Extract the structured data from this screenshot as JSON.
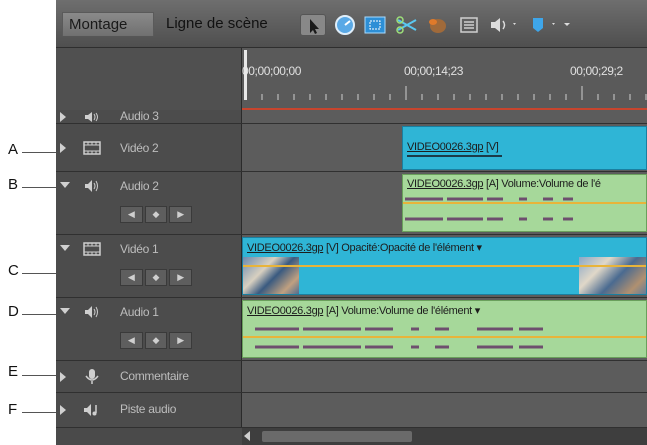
{
  "tabs": {
    "montage": "Montage",
    "ligne": "Ligne de scène"
  },
  "ruler": {
    "t0": "00;00;00;00",
    "t1": "00;00;14;23",
    "t2": "00;00;29;2"
  },
  "tracks": {
    "audio3": "Audio 3",
    "video2": "Vidéo 2",
    "audio2": "Audio 2",
    "video1": "Vidéo 1",
    "audio1": "Audio 1",
    "commentaire": "Commentaire",
    "piste": "Piste audio"
  },
  "clips": {
    "v2_file": "VIDEO0026.3gp",
    "v2_tag": " [V]",
    "a2_file": "VIDEO0026.3gp",
    "a2_tag": " [A]  Volume:Volume de l'é",
    "v1_file": "VIDEO0026.3gp",
    "v1_tag": " [V]  Opacité:Opacité de l'élément ▾",
    "a1_file": "VIDEO0026.3gp",
    "a1_tag": " [A]  Volume:Volume de l'élément ▾"
  },
  "keyframe_nav": {
    "prev": "◀",
    "add": "◆",
    "next": "▶"
  },
  "callouts": {
    "a": "A",
    "b": "B",
    "c": "C",
    "d": "D",
    "e": "E",
    "f": "F"
  },
  "colors": {
    "video_clip": "#2fb5d6",
    "audio_clip": "#a6d89a",
    "ruler_marker": "#c8452e"
  },
  "icons": [
    "selection-tool-icon",
    "time-stretch-icon",
    "scene-icon",
    "split-icon",
    "smart-trim-icon",
    "menu-icon",
    "volume-icon",
    "marker-icon"
  ]
}
